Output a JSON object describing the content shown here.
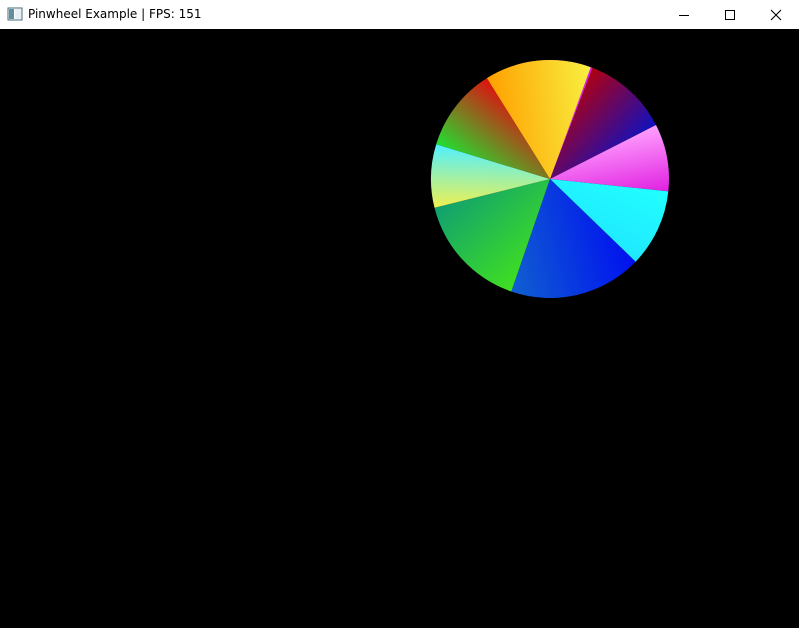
{
  "window": {
    "title": "Pinwheel Example | FPS: 151",
    "app_icon": "window-app-icon",
    "controls": {
      "minimize_icon": "minimize-icon",
      "maximize_icon": "maximize-icon",
      "close_icon": "close-icon"
    }
  },
  "scene": {
    "background": "#000000",
    "pinwheel": {
      "blades": [
        {
          "name": "blade-1",
          "from": "#ff8a8a",
          "to": "#d818f0"
        },
        {
          "name": "blade-2",
          "from": "#b00010",
          "to": "#1010c0"
        },
        {
          "name": "blade-3",
          "from": "#ffa0ff",
          "to": "#e020e0"
        },
        {
          "name": "blade-4",
          "from": "#20ffff",
          "to": "#20e8ff"
        },
        {
          "name": "blade-5",
          "from": "#0010f0",
          "to": "#1060d0"
        },
        {
          "name": "blade-6",
          "from": "#40e020",
          "to": "#10a070"
        },
        {
          "name": "blade-7",
          "from": "#f0f050",
          "to": "#50f0ff"
        },
        {
          "name": "blade-8",
          "from": "#20e030",
          "to": "#e01010"
        },
        {
          "name": "blade-9",
          "from": "#ffa000",
          "to": "#f8f040"
        }
      ]
    }
  }
}
